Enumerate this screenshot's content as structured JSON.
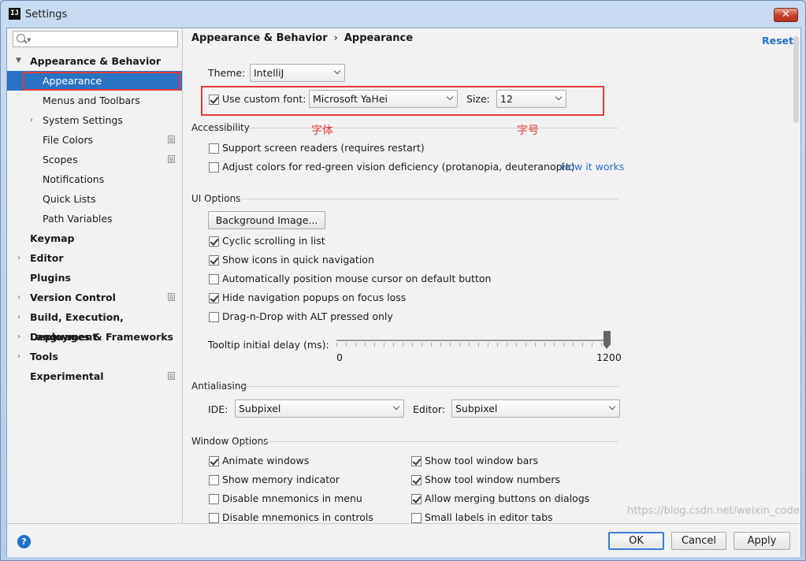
{
  "window": {
    "title": "Settings",
    "app_icon": "IJ",
    "close_glyph": "✕"
  },
  "search": {
    "placeholder": ""
  },
  "sidebar": {
    "items": [
      {
        "label": "Appearance & Behavior",
        "bold": true,
        "expanded": true
      },
      {
        "label": "Appearance",
        "selected": true
      },
      {
        "label": "Menus and Toolbars"
      },
      {
        "label": "System Settings",
        "collapsed": true
      },
      {
        "label": "File Colors",
        "project_icon": true
      },
      {
        "label": "Scopes",
        "project_icon": true
      },
      {
        "label": "Notifications"
      },
      {
        "label": "Quick Lists"
      },
      {
        "label": "Path Variables"
      },
      {
        "label": "Keymap",
        "bold": true
      },
      {
        "label": "Editor",
        "bold": true,
        "collapsed": true
      },
      {
        "label": "Plugins",
        "bold": true
      },
      {
        "label": "Version Control",
        "bold": true,
        "collapsed": true,
        "project_icon": true
      },
      {
        "label": "Build, Execution, Deployment",
        "bold": true,
        "collapsed": true
      },
      {
        "label": "Languages & Frameworks",
        "bold": true,
        "collapsed": true
      },
      {
        "label": "Tools",
        "bold": true,
        "collapsed": true
      },
      {
        "label": "Experimental",
        "bold": true,
        "project_icon": true
      }
    ]
  },
  "header": {
    "crumb1": "Appearance & Behavior",
    "sep": "›",
    "crumb2": "Appearance",
    "reset": "Reset"
  },
  "theme": {
    "label": "Theme:",
    "value": "IntelliJ"
  },
  "font": {
    "checkbox_label": "Use custom font:",
    "checked": true,
    "value": "Microsoft YaHei",
    "size_label": "Size:",
    "size_value": "12"
  },
  "annotations": {
    "font_note": "字体",
    "size_note": "字号"
  },
  "accessibility": {
    "title": "Accessibility",
    "screen_readers": "Support screen readers (requires restart)",
    "adjust_colors": "Adjust colors for red-green vision deficiency (protanopia, deuteranopia)",
    "how_it_works": "How it works"
  },
  "ui_options": {
    "title": "UI Options",
    "background_image": "Background Image...",
    "cyclic": "Cyclic scrolling in list",
    "show_icons": "Show icons in quick navigation",
    "auto_cursor": "Automatically position mouse cursor on default button",
    "hide_popups": "Hide navigation popups on focus loss",
    "dnd": "Drag-n-Drop with ALT pressed only",
    "tooltip_label": "Tooltip initial delay (ms):",
    "slider_min": "0",
    "slider_max": "1200",
    "slider_value": 1200
  },
  "antialiasing": {
    "title": "Antialiasing",
    "ide_label": "IDE:",
    "ide_value": "Subpixel",
    "editor_label": "Editor:",
    "editor_value": "Subpixel"
  },
  "window_options": {
    "title": "Window Options",
    "animate": "Animate windows",
    "memory": "Show memory indicator",
    "mnem_menu": "Disable mnemonics in menu",
    "mnem_controls": "Disable mnemonics in controls",
    "tool_bars": "Show tool window bars",
    "tool_numbers": "Show tool window numbers",
    "merging": "Allow merging buttons on dialogs",
    "small_labels": "Small labels in editor tabs"
  },
  "buttons": {
    "ok": "OK",
    "cancel": "Cancel",
    "apply": "Apply",
    "help": "?"
  },
  "watermark": "https://blog.csdn.net/weixin_code"
}
